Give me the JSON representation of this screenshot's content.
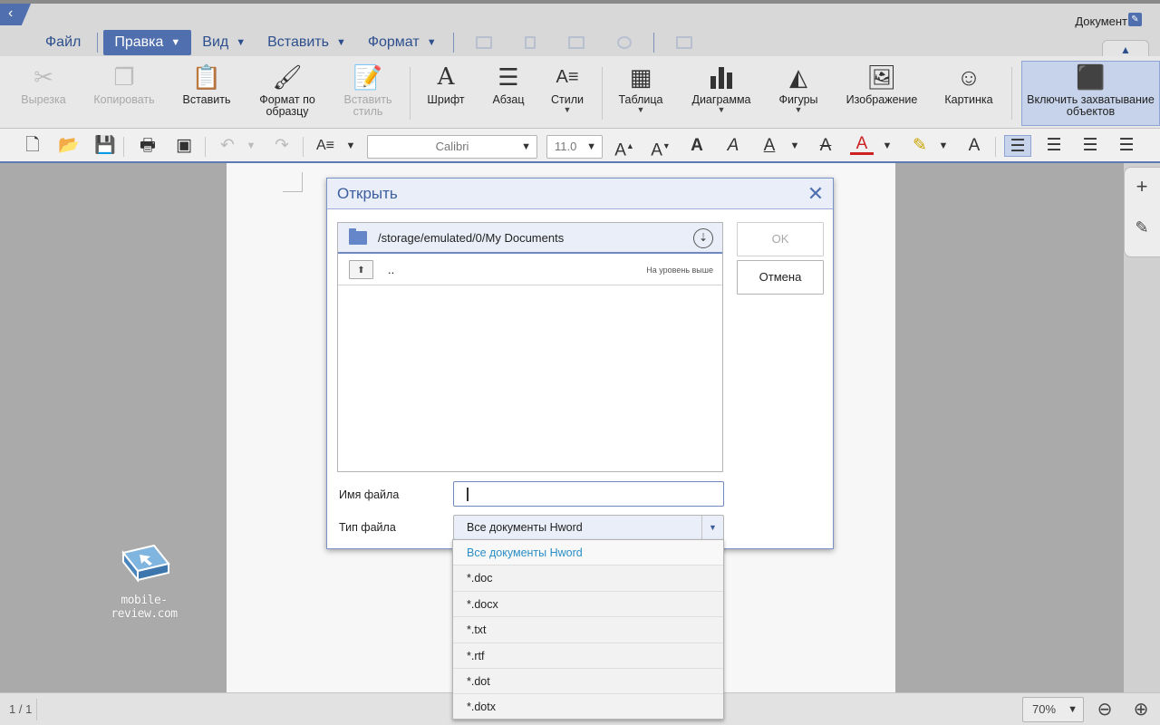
{
  "header": {
    "doc_label": "Документ",
    "menu": [
      {
        "label": "Файл"
      },
      {
        "label": "Правка"
      },
      {
        "label": "Вид"
      },
      {
        "label": "Вставить"
      },
      {
        "label": "Формат"
      }
    ]
  },
  "ribbon": {
    "cut": "Вырезка",
    "copy": "Копировать",
    "paste": "Вставить",
    "format_painter": "Формат по образцу",
    "paste_style": "Вставить стиль",
    "font": "Шрифт",
    "paragraph": "Абзац",
    "styles": "Стили",
    "table": "Таблица",
    "chart": "Диаграмма",
    "shapes": "Фигуры",
    "image": "Изображение",
    "picture": "Картинка",
    "capture": "Включить захватывание объектов"
  },
  "toolbar": {
    "font_name": "Calibri",
    "font_size": "11.0"
  },
  "dialog": {
    "title": "Открыть",
    "path": "/storage/emulated/0/My Documents",
    "up_name": "..",
    "up_hint": "На уровень выше",
    "ok_label": "OK",
    "cancel_label": "Отмена",
    "filename_label": "Имя файла",
    "filename_value": "",
    "filetype_label": "Тип файла",
    "filetype_value": "Все документы Hword",
    "filetype_options": [
      "Все документы Hword",
      "*.doc",
      "*.docx",
      "*.txt",
      "*.rtf",
      "*.dot",
      "*.dotx"
    ]
  },
  "status": {
    "page_counter": "1 / 1",
    "zoom": "70%"
  },
  "watermark": {
    "text": "mobile-review.com"
  },
  "colors": {
    "accent": "#4f6fae",
    "menu_text": "#2e4f8e",
    "selected_option": "#2a8ec5"
  }
}
